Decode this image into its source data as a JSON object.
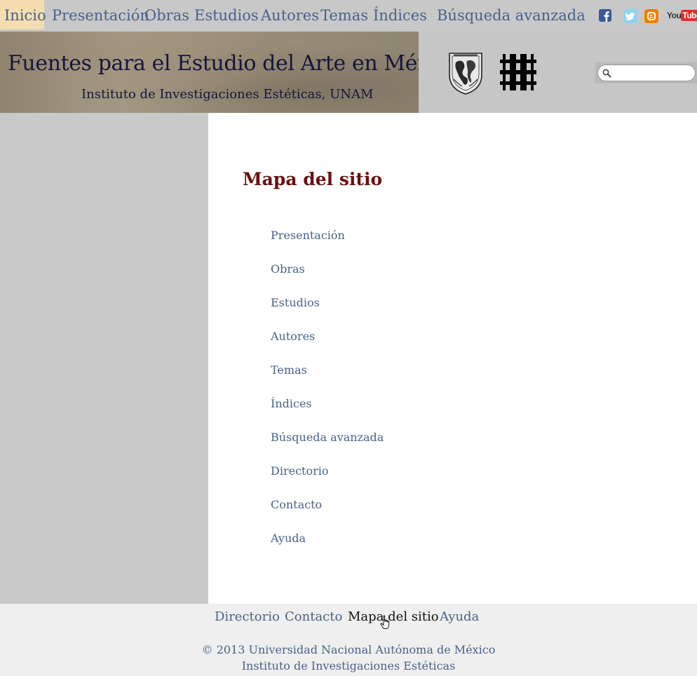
{
  "nav": {
    "items": [
      {
        "label": "Inicio"
      },
      {
        "label": "Presentación"
      },
      {
        "label": "Obras"
      },
      {
        "label": "Estudios"
      },
      {
        "label": "Autores"
      },
      {
        "label": "Temas"
      },
      {
        "label": "Índices"
      },
      {
        "label": "Búsqueda avanzada"
      }
    ],
    "active_index": 0,
    "social": [
      {
        "icon": "facebook-icon",
        "color": "#3b5998"
      },
      {
        "icon": "twitter-icon",
        "color": "#5bb8e8"
      },
      {
        "icon": "blogger-icon",
        "color": "#f57d00"
      },
      {
        "icon": "youtube-icon",
        "label": "YouTube",
        "color": "#e52d27"
      }
    ]
  },
  "header": {
    "title": "Fuentes para el Estudio del Arte en México",
    "subtitle": "Instituto de Investigaciones Estéticas, UNAM",
    "logos": [
      "unam-seal-icon",
      "iie-logo-icon"
    ],
    "search": {
      "placeholder": "",
      "icon": "search-icon"
    }
  },
  "main": {
    "title": "Mapa del sitio",
    "links": [
      "Presentación",
      "Obras",
      "Estudios",
      "Autores",
      "Temas",
      "Índices",
      "Búsqueda avanzada",
      "Directorio",
      "Contacto",
      "Ayuda"
    ]
  },
  "footer": {
    "links": [
      {
        "label": "Directorio"
      },
      {
        "label": "Contacto"
      },
      {
        "label": "Mapa del sitio"
      },
      {
        "label": "Ayuda"
      }
    ],
    "current_index": 2,
    "copyright": "© 2013 Universidad Nacional Autónoma de México",
    "institute": "Instituto de Investigaciones Estéticas"
  },
  "colors": {
    "link": "#4a6288",
    "title": "#6b0f0f",
    "active_tab": "#f4ddb0",
    "nav_bg": "#c8c8c8",
    "sidebar_bg": "#c9c9c9",
    "footer_bg": "#efefef"
  }
}
